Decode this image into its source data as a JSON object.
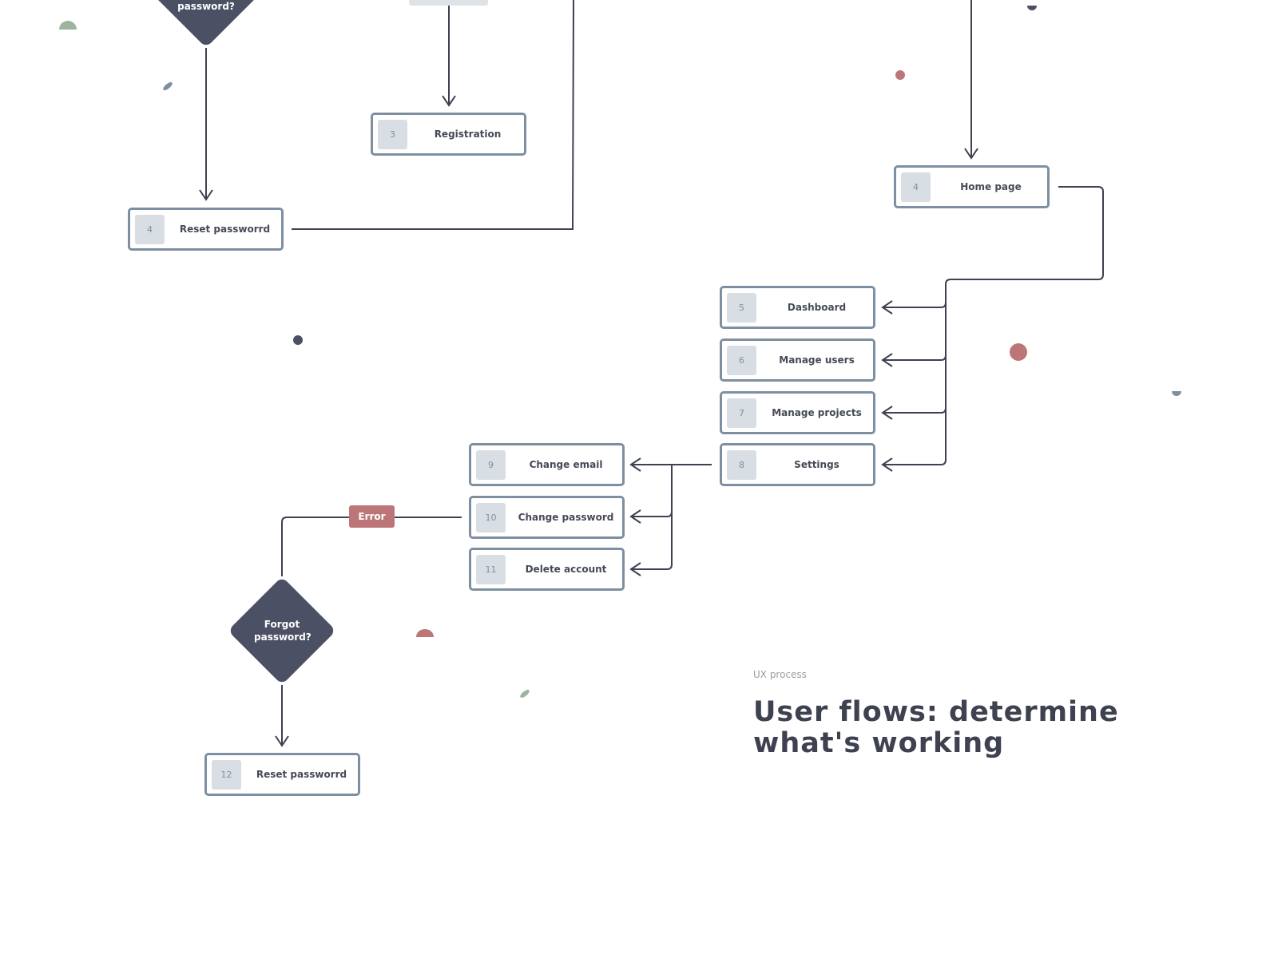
{
  "colors": {
    "node_border": "#7d8fa0",
    "chip": "#d9dee4",
    "diamond": "#4c5064",
    "error": "#bc7677",
    "line": "#3d4150",
    "accent_green": "#9cb59c"
  },
  "nodes": [
    {
      "num": "3",
      "label": "Registration"
    },
    {
      "num": "4",
      "label": "Reset passworrd"
    },
    {
      "num": "4",
      "label": "Home page"
    },
    {
      "num": "5",
      "label": "Dashboard"
    },
    {
      "num": "6",
      "label": "Manage users"
    },
    {
      "num": "7",
      "label": "Manage projects"
    },
    {
      "num": "8",
      "label": "Settings"
    },
    {
      "num": "9",
      "label": "Change email"
    },
    {
      "num": "10",
      "label": "Change password"
    },
    {
      "num": "11",
      "label": "Delete account"
    },
    {
      "num": "12",
      "label": "Reset passworrd"
    }
  ],
  "decisions": [
    {
      "label": "password?"
    },
    {
      "label": "Forgot password?"
    }
  ],
  "error_label": "Error",
  "caption": {
    "eyebrow": "UX process",
    "title": "User flows: determine what's working"
  }
}
